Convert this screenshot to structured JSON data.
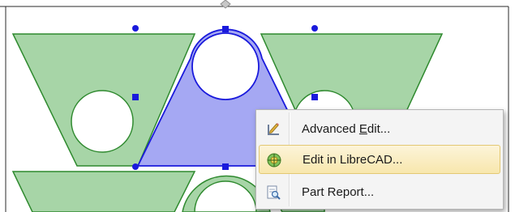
{
  "canvas": {
    "part_fill": "#a7d5a7",
    "part_stroke": "#2f8a2f",
    "selected_fill": "#a5a8f3",
    "selected_stroke": "#1a1adc",
    "handle_color": "#1a1adc",
    "rotate_handle_color": "#bfbfbf"
  },
  "context_menu": {
    "items": [
      {
        "label_before": "Advanced ",
        "mnemonic": "E",
        "label_after": "dit...",
        "icon": "pencil-ruler-icon",
        "highlighted": false
      },
      {
        "label_before": "Edit in LibreCAD...",
        "mnemonic": "",
        "label_after": "",
        "icon": "librecad-icon",
        "highlighted": true
      },
      {
        "label_before": "Part Report...",
        "mnemonic": "",
        "label_after": "",
        "icon": "report-magnifier-icon",
        "highlighted": false
      }
    ]
  }
}
